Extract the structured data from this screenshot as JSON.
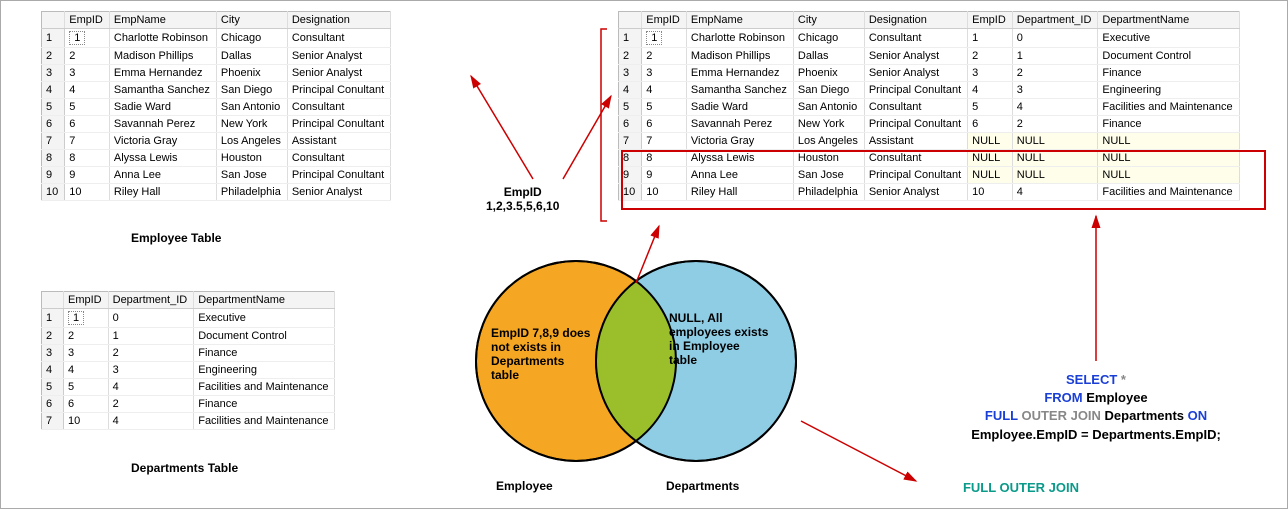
{
  "employeeTable": {
    "caption": "Employee Table",
    "headers": [
      "",
      "EmpID",
      "EmpName",
      "City",
      "Designation"
    ],
    "rows": [
      [
        "1",
        "1",
        "Charlotte Robinson",
        "Chicago",
        "Consultant"
      ],
      [
        "2",
        "2",
        "Madison Phillips",
        "Dallas",
        "Senior Analyst"
      ],
      [
        "3",
        "3",
        "Emma Hernandez",
        "Phoenix",
        "Senior Analyst"
      ],
      [
        "4",
        "4",
        "Samantha Sanchez",
        "San Diego",
        "Principal Conultant"
      ],
      [
        "5",
        "5",
        "Sadie Ward",
        "San Antonio",
        "Consultant"
      ],
      [
        "6",
        "6",
        "Savannah Perez",
        "New York",
        "Principal Conultant"
      ],
      [
        "7",
        "7",
        "Victoria Gray",
        "Los Angeles",
        "Assistant"
      ],
      [
        "8",
        "8",
        "Alyssa Lewis",
        "Houston",
        "Consultant"
      ],
      [
        "9",
        "9",
        "Anna Lee",
        "San Jose",
        "Principal Conultant"
      ],
      [
        "10",
        "10",
        "Riley Hall",
        "Philadelphia",
        "Senior Analyst"
      ]
    ]
  },
  "departmentsTable": {
    "caption": "Departments Table",
    "headers": [
      "",
      "EmpID",
      "Department_ID",
      "DepartmentName"
    ],
    "rows": [
      [
        "1",
        "1",
        "0",
        "Executive"
      ],
      [
        "2",
        "2",
        "1",
        "Document Control"
      ],
      [
        "3",
        "3",
        "2",
        "Finance"
      ],
      [
        "4",
        "4",
        "3",
        "Engineering"
      ],
      [
        "5",
        "5",
        "4",
        "Facilities and Maintenance"
      ],
      [
        "6",
        "6",
        "2",
        "Finance"
      ],
      [
        "7",
        "10",
        "4",
        "Facilities and Maintenance"
      ]
    ]
  },
  "joinTable": {
    "headers": [
      "",
      "EmpID",
      "EmpName",
      "City",
      "Designation",
      "EmpID",
      "Department_ID",
      "DepartmentName"
    ],
    "rows": [
      {
        "null": false,
        "cells": [
          "1",
          "1",
          "Charlotte Robinson",
          "Chicago",
          "Consultant",
          "1",
          "0",
          "Executive"
        ]
      },
      {
        "null": false,
        "cells": [
          "2",
          "2",
          "Madison Phillips",
          "Dallas",
          "Senior Analyst",
          "2",
          "1",
          "Document Control"
        ]
      },
      {
        "null": false,
        "cells": [
          "3",
          "3",
          "Emma Hernandez",
          "Phoenix",
          "Senior Analyst",
          "3",
          "2",
          "Finance"
        ]
      },
      {
        "null": false,
        "cells": [
          "4",
          "4",
          "Samantha Sanchez",
          "San Diego",
          "Principal Conultant",
          "4",
          "3",
          "Engineering"
        ]
      },
      {
        "null": false,
        "cells": [
          "5",
          "5",
          "Sadie Ward",
          "San Antonio",
          "Consultant",
          "5",
          "4",
          "Facilities and Maintenance"
        ]
      },
      {
        "null": false,
        "cells": [
          "6",
          "6",
          "Savannah Perez",
          "New York",
          "Principal Conultant",
          "6",
          "2",
          "Finance"
        ]
      },
      {
        "null": true,
        "cells": [
          "7",
          "7",
          "Victoria Gray",
          "Los Angeles",
          "Assistant",
          "NULL",
          "NULL",
          "NULL"
        ]
      },
      {
        "null": true,
        "cells": [
          "8",
          "8",
          "Alyssa Lewis",
          "Houston",
          "Consultant",
          "NULL",
          "NULL",
          "NULL"
        ]
      },
      {
        "null": true,
        "cells": [
          "9",
          "9",
          "Anna Lee",
          "San Jose",
          "Principal Conultant",
          "NULL",
          "NULL",
          "NULL"
        ]
      },
      {
        "null": false,
        "cells": [
          "10",
          "10",
          "Riley Hall",
          "Philadelphia",
          "Senior Analyst",
          "10",
          "4",
          "Facilities and Maintenance"
        ]
      }
    ]
  },
  "venn": {
    "leftLabel": "Employee",
    "rightLabel": "Departments",
    "leftText": "EmpID 7,8,9 does not exists in Departments table",
    "rightText": "NULL, All employees exists in Employee table"
  },
  "annot": {
    "empIds": "EmpID\n1,2,3.5,5,6,10"
  },
  "sql": {
    "line1a": "SELECT",
    "line1b": " *",
    "line2a": "FROM",
    "line2b": " Employee",
    "line3a": "FULL",
    "line3b": " OUTER JOIN ",
    "line3c": "Departments ",
    "line3d": "ON",
    "line4": "Employee.EmpID = Departments.EmpID;",
    "title": "FULL OUTER JOIN"
  }
}
